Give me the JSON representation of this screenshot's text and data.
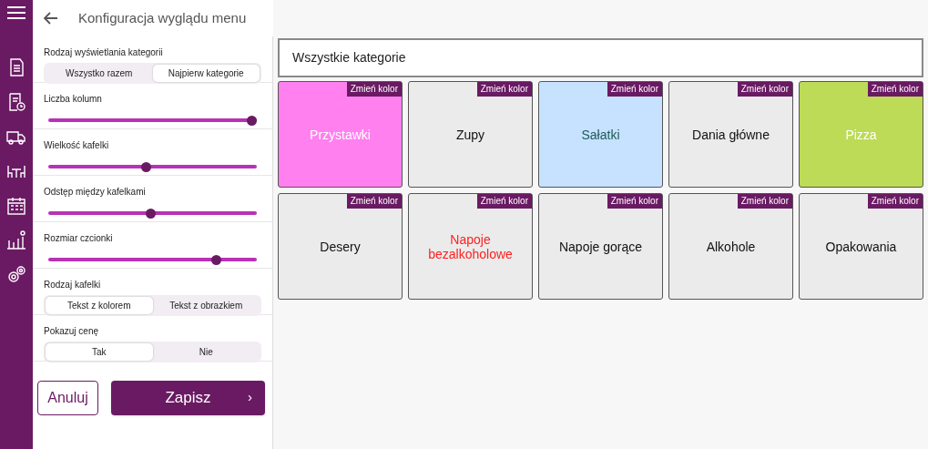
{
  "header": {
    "title": "Konfiguracja wyglądu menu"
  },
  "settings": [
    {
      "kind": "segmented",
      "label": "Rodzaj wyświetlania kategorii",
      "options": [
        {
          "label": "Wszystko razem",
          "selected": false
        },
        {
          "label": "Najpierw kategorie",
          "selected": true
        }
      ]
    },
    {
      "kind": "slider",
      "label": "Liczba kolumn",
      "level": 1
    },
    {
      "kind": "slider",
      "label": "Wielkość kafelki",
      "level": 0.47
    },
    {
      "kind": "slider",
      "label": "Odstęp między kafelkami",
      "level": 0.49
    },
    {
      "kind": "slider",
      "label": "Rozmiar czcionki",
      "level": 0.82
    },
    {
      "kind": "segmented",
      "label": "Rodzaj kafelki",
      "options": [
        {
          "label": "Tekst z kolorem",
          "selected": true
        },
        {
          "label": "Tekst z obrazkiem",
          "selected": false
        }
      ]
    },
    {
      "kind": "segmented",
      "label": "Pokazuj cenę",
      "options": [
        {
          "label": "Tak",
          "selected": true
        },
        {
          "label": "Nie",
          "selected": false
        }
      ]
    }
  ],
  "buttons": {
    "cancel": "Anuluj",
    "save": "Zapisz",
    "save_icon": "›"
  },
  "category_bar": {
    "title": "Wszystkie kategorie"
  },
  "tiles": [
    {
      "badge": "Zmień kolor",
      "color": "#ff80ee",
      "label": {
        "text": "Przystawki",
        "color": "#ffffff"
      }
    },
    {
      "badge": "Zmień kolor",
      "color": "#ebebeb",
      "label": {
        "text": "Zupy",
        "color": "#111111"
      }
    },
    {
      "badge": "Zmień kolor",
      "color": "#c6e2ff",
      "label": {
        "text": "Sałatki",
        "color": "#1f5a5a"
      }
    },
    {
      "badge": "Zmień kolor",
      "color": "#ebebeb",
      "label": {
        "text": "Dania główne",
        "color": "#111111"
      }
    },
    {
      "badge": "Zmień kolor",
      "color": "#bddb57",
      "label": {
        "text": "Pizza",
        "color": "#ffffff"
      }
    },
    {
      "badge": "Zmień kolor",
      "color": "#ebebeb",
      "label": {
        "text": "Desery",
        "color": "#111111"
      }
    },
    {
      "badge": "Zmień kolor",
      "color": "#ebebeb",
      "label": {
        "text": "Napoje bezalkoholowe",
        "color": "#ff2020"
      }
    },
    {
      "badge": "Zmień kolor",
      "color": "#ebebeb",
      "label": {
        "text": "Napoje gorące",
        "color": "#111111"
      }
    },
    {
      "badge": "Zmień kolor",
      "color": "#ebebeb",
      "label": {
        "text": "Alkohole",
        "color": "#111111"
      }
    },
    {
      "badge": "Zmień kolor",
      "color": "#ebebeb",
      "label": {
        "text": "Opakowania",
        "color": "#111111"
      }
    }
  ]
}
